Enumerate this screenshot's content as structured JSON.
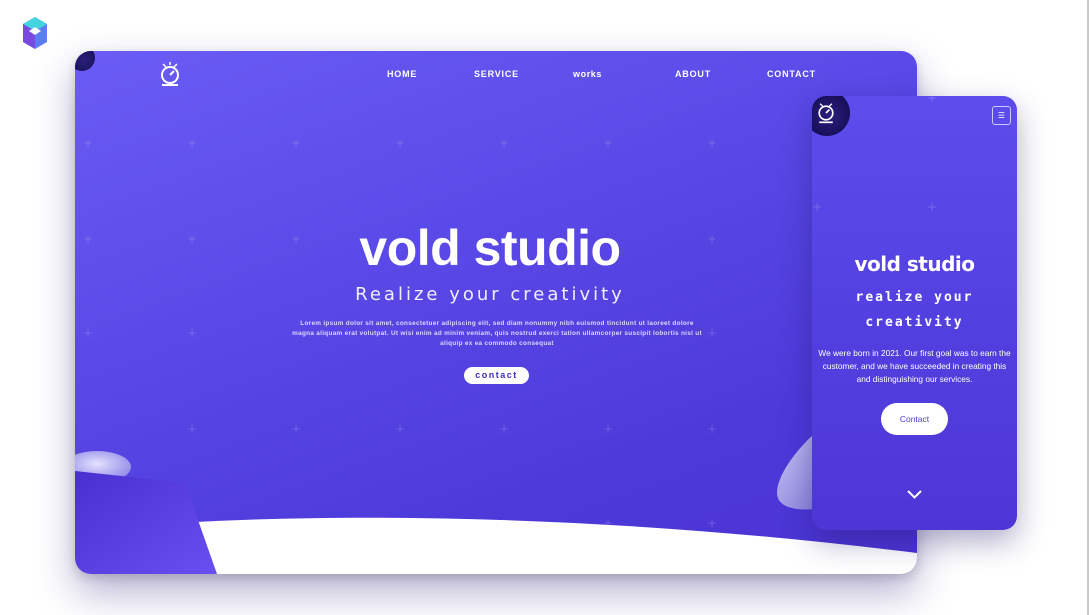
{
  "brand": {
    "accent": "#5b4be8",
    "logo_colors": [
      "#5b7cf5",
      "#44d4e0",
      "#7a4ae0"
    ]
  },
  "desktop": {
    "nav": {
      "items": [
        {
          "label": "HOME"
        },
        {
          "label": "SERVICE"
        },
        {
          "label": "works"
        },
        {
          "label": "ABOUT"
        },
        {
          "label": "CONTACT"
        }
      ]
    },
    "hero": {
      "title": "vold studio",
      "subtitle": "Realize your creativity",
      "text": "Lorem ipsum dolor sit amet, consectetuer adipiscing elit, sed diam nonummy nibh euismod tincidunt ut laoreet dolore magna aliquam erat volutpat. Ut wisi enim ad minim veniam, quis nostrud exerci tation ullamcorper suscipit lobortis nisl ut aliquip ex ea commodo consequat",
      "button_label": "contact"
    }
  },
  "mobile": {
    "menu_icon": "hamburger-icon",
    "title": "vold studio",
    "subtitle": "realize your creativity",
    "text": "We were born in 2021. Our first goal was to earn the customer, and we have succeeded in creating this and distinguishing our services.",
    "button_label": "Contact",
    "scroll_icon": "chevron-down-icon"
  }
}
